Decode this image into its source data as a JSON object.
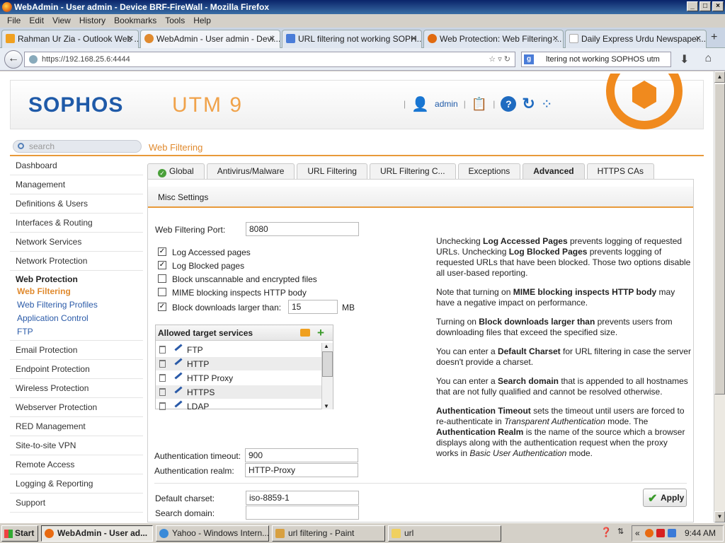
{
  "window": {
    "title": "WebAdmin - User admin - Device BRF-FireWall - Mozilla Firefox"
  },
  "menubar": [
    "File",
    "Edit",
    "View",
    "History",
    "Bookmarks",
    "Tools",
    "Help"
  ],
  "browser_tabs": [
    {
      "label": "Rahman Ur Zia - Outlook Web ...",
      "icon_color": "#f0a020"
    },
    {
      "label": "WebAdmin - User admin - Devi...",
      "icon_color": "#e08a2e"
    },
    {
      "label": "URL filtering not working SOPH...",
      "icon_color": "#4a7cd8"
    },
    {
      "label": "Web Protection: Web Filtering ...",
      "icon_color": "#e06a10"
    },
    {
      "label": "Daily Express Urdu Newspaper...",
      "icon_color": "#aaaaaa"
    }
  ],
  "address": {
    "url": "https://192.168.25.6:4444"
  },
  "search": {
    "value": "ltering not working SOPHOS utm"
  },
  "header": {
    "logo": "SOPHOS",
    "product": "UTM 9",
    "user": "admin"
  },
  "sidebar": {
    "search_placeholder": "search",
    "items": [
      "Dashboard",
      "Management",
      "Definitions & Users",
      "Interfaces & Routing",
      "Network Services",
      "Network Protection"
    ],
    "group": "Web Protection",
    "subitems": [
      "Web Filtering",
      "Web Filtering Profiles",
      "Application Control",
      "FTP"
    ],
    "items2": [
      "Email Protection",
      "Endpoint Protection",
      "Wireless Protection",
      "Webserver Protection",
      "RED Management",
      "Site-to-site VPN",
      "Remote Access",
      "Logging & Reporting",
      "Support"
    ]
  },
  "page": {
    "title": "Web Filtering"
  },
  "tabs": [
    "Global",
    "Antivirus/Malware",
    "URL Filtering",
    "URL Filtering C...",
    "Exceptions",
    "Advanced",
    "HTTPS CAs"
  ],
  "panel": {
    "title": "Misc Settings",
    "port_label": "Web Filtering Port:",
    "port_value": "8080",
    "checkboxes": [
      {
        "label": "Log Accessed pages",
        "checked": true
      },
      {
        "label": "Log Blocked pages",
        "checked": true
      },
      {
        "label": "Block unscannable and encrypted files",
        "checked": false
      },
      {
        "label": "MIME blocking inspects HTTP body",
        "checked": false
      },
      {
        "label": "Block downloads larger than:",
        "checked": true
      }
    ],
    "block_size": "15",
    "block_unit": "MB",
    "services_title": "Allowed target services",
    "services": [
      "FTP",
      "HTTP",
      "HTTP Proxy",
      "HTTPS",
      "LDAP"
    ],
    "charset_label": "Default charset:",
    "charset_value": "iso-8859-1",
    "domain_label": "Search domain:",
    "domain_value": "",
    "timeout_label": "Authentication timeout:",
    "timeout_value": "900",
    "realm_label": "Authentication realm:",
    "realm_value": "HTTP-Proxy",
    "apply": "Apply"
  },
  "help": {
    "p1a": "Unchecking ",
    "p1b": "Log Accessed Pages",
    "p1c": " prevents logging of requested URLs. Unchecking ",
    "p1d": "Log Blocked Pages",
    "p1e": " prevents logging of requested URLs that have been blocked. Those two options disable all user-based reporting.",
    "p2a": "Note that turning on ",
    "p2b": "MIME blocking inspects HTTP body",
    "p2c": " may have a negative impact on performance.",
    "p3a": "Turning on ",
    "p3b": "Block downloads larger than",
    "p3c": " prevents users from downloading files that exceed the specified size.",
    "p4a": "You can enter a ",
    "p4b": "Default Charset",
    "p4c": " for URL filtering in case the server doesn't provide a charset.",
    "p5a": "You can enter a ",
    "p5b": "Search domain",
    "p5c": " that is appended to all hostnames that are not fully qualified and cannot be resolved otherwise.",
    "p6a": "Authentication Timeout",
    "p6b": " sets the timeout until users are forced to re-authenticate in ",
    "p6c": "Transparent Authentication",
    "p6d": " mode. The ",
    "p6e": "Authentication Realm",
    "p6f": " is the name of the source which a browser displays along with the authentication request when the proxy works in ",
    "p6g": "Basic User Authentication",
    "p6h": " mode."
  },
  "taskbar": {
    "start": "Start",
    "tasks": [
      "WebAdmin - User ad...",
      "Yahoo - Windows Intern...",
      "url filtering - Paint",
      "url"
    ],
    "clock": "9:44 AM"
  }
}
